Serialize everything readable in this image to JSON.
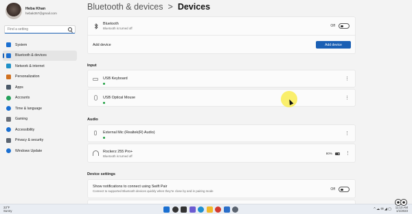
{
  "profile": {
    "name": "Heba Khan",
    "email": "hebak357@gmail.com"
  },
  "search": {
    "placeholder": "Find a setting"
  },
  "nav": [
    {
      "label": "System",
      "icon": "system-icon",
      "color": "#1a6fd1"
    },
    {
      "label": "Bluetooth & devices",
      "icon": "bluetooth-devices-icon",
      "color": "#1a6fd1",
      "active": true
    },
    {
      "label": "Network & internet",
      "icon": "network-icon",
      "color": "#1e90c8"
    },
    {
      "label": "Personalization",
      "icon": "brush-icon",
      "color": "#d0701f"
    },
    {
      "label": "Apps",
      "icon": "apps-icon",
      "color": "#4a5968"
    },
    {
      "label": "Accounts",
      "icon": "accounts-icon",
      "color": "#23a05a"
    },
    {
      "label": "Time & language",
      "icon": "globe-clock-icon",
      "color": "#1a6fd1"
    },
    {
      "label": "Gaming",
      "icon": "gamepad-icon",
      "color": "#6a6f77"
    },
    {
      "label": "Accessibility",
      "icon": "accessibility-icon",
      "color": "#1a6fd1"
    },
    {
      "label": "Privacy & security",
      "icon": "shield-icon",
      "color": "#5b6470"
    },
    {
      "label": "Windows Update",
      "icon": "update-icon",
      "color": "#1a6fd1"
    }
  ],
  "header": {
    "parent": "Bluetooth & devices",
    "separator": ">",
    "current": "Devices"
  },
  "bluetooth": {
    "title": "Bluetooth",
    "status": "Bluetooth is turned off",
    "toggle_label": "Off"
  },
  "add_device": {
    "label": "Add device",
    "button": "Add device"
  },
  "sections": {
    "input": "Input",
    "audio": "Audio",
    "device_settings": "Device settings"
  },
  "input_devices": [
    {
      "name": "USB Keyboard",
      "icon": "keyboard-icon"
    },
    {
      "name": "USB Optical Mouse",
      "icon": "mouse-icon"
    }
  ],
  "audio_devices": [
    {
      "name": "External Mic (Realtek(R) Audio)",
      "icon": "microphone-icon",
      "status": ""
    },
    {
      "name": "Rockerz 255 Pro+",
      "icon": "headphones-icon",
      "status": "Bluetooth is turned off",
      "battery": "80%"
    }
  ],
  "swift_pair": {
    "title": "Show notifications to connect using Swift Pair",
    "desc": "Connect to supported Bluetooth devices quickly when they're close by and in pairing mode",
    "toggle_label": "Off"
  },
  "more_glyph": "⋮",
  "taskbar": {
    "temperature": "33°F",
    "weather": "Sunny",
    "time": "11:10 AM",
    "date": "1/1/2023",
    "sys_icons": "^ ☁ ✉ ◢ ▢",
    "app_icons": [
      {
        "name": "start-icon",
        "color": "#1a6fd1"
      },
      {
        "name": "search-icon",
        "color": "#333333"
      },
      {
        "name": "task-view-icon",
        "color": "#333333"
      },
      {
        "name": "widgets-icon",
        "color": "#6b5bd1"
      },
      {
        "name": "edge-icon",
        "color": "#1f8fcf"
      },
      {
        "name": "file-explorer-icon",
        "color": "#f2b929"
      },
      {
        "name": "chrome-icon",
        "color": "#d33b2f"
      },
      {
        "name": "store-icon",
        "color": "#2a6ec9"
      },
      {
        "name": "settings-icon",
        "color": "#5b6470"
      }
    ]
  }
}
